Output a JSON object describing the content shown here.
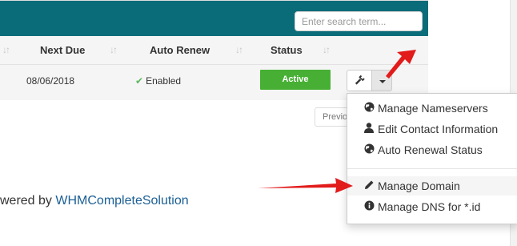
{
  "search": {
    "placeholder": "Enter search term..."
  },
  "table": {
    "headers": {
      "next_due": "Next Due",
      "auto_renew": "Auto Renew",
      "status": "Status"
    },
    "row": {
      "next_due": "08/06/2018",
      "auto_renew": "Enabled",
      "status": "Active"
    }
  },
  "pagination": {
    "previous": "Previous"
  },
  "footer": {
    "prefix": "wered by ",
    "link": "WHMCompleteSolution"
  },
  "menu": {
    "items": [
      {
        "label": "Manage Nameservers",
        "icon": "globe-icon"
      },
      {
        "label": "Edit Contact Information",
        "icon": "user-icon"
      },
      {
        "label": "Auto Renewal Status",
        "icon": "globe-icon"
      },
      {
        "label": "Manage Domain",
        "icon": "pencil-icon"
      },
      {
        "label": "Manage DNS for *.id",
        "icon": "info-circle-icon"
      }
    ]
  },
  "colors": {
    "header": "#0a6c79",
    "active_badge": "#47b034",
    "link": "#1b5f95",
    "arrow": "#e21b1b"
  }
}
